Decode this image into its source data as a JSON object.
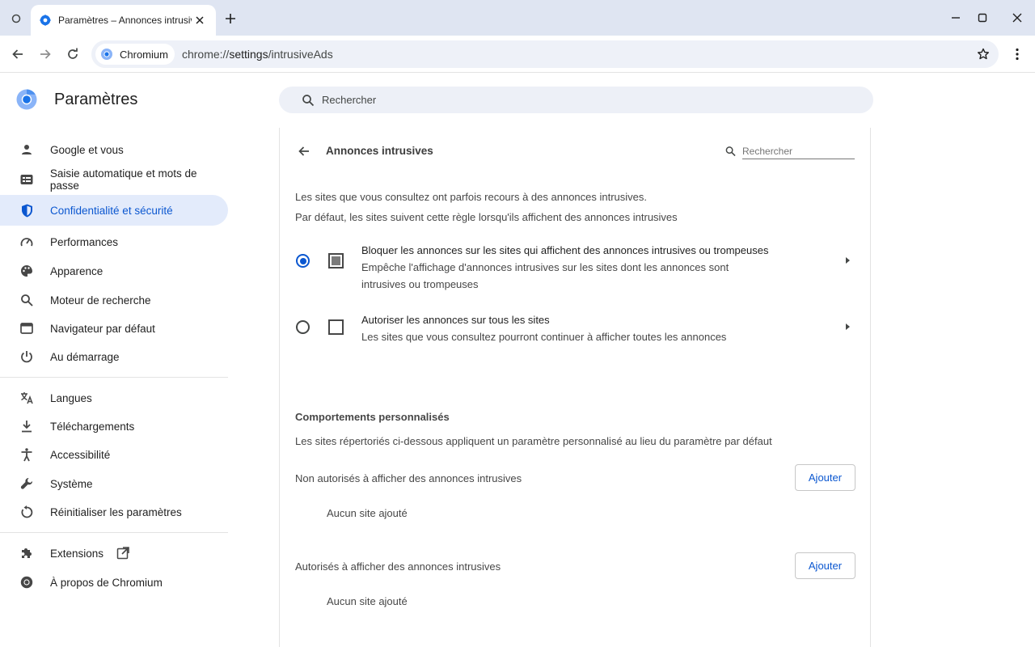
{
  "browser": {
    "tab_title": "Paramètres – Annonces intrusives",
    "chip_label": "Chromium",
    "url_scheme": "chrome://",
    "url_host": "settings",
    "url_path": "/intrusiveAds"
  },
  "settings": {
    "title": "Paramètres",
    "search_placeholder": "Rechercher"
  },
  "sidebar": {
    "items": [
      {
        "label": "Google et vous",
        "icon": "person-icon"
      },
      {
        "label": "Saisie automatique et mots de passe",
        "icon": "autofill-icon"
      },
      {
        "label": "Confidentialité et sécurité",
        "icon": "shield-icon",
        "active": true
      },
      {
        "label": "Performances",
        "icon": "speedometer-icon"
      },
      {
        "label": "Apparence",
        "icon": "palette-icon"
      },
      {
        "label": "Moteur de recherche",
        "icon": "search-icon"
      },
      {
        "label": "Navigateur par défaut",
        "icon": "browser-window-icon"
      },
      {
        "label": "Au démarrage",
        "icon": "power-icon"
      },
      {
        "label": "Langues",
        "icon": "translate-icon"
      },
      {
        "label": "Téléchargements",
        "icon": "download-icon"
      },
      {
        "label": "Accessibilité",
        "icon": "accessibility-icon"
      },
      {
        "label": "Système",
        "icon": "wrench-icon"
      },
      {
        "label": "Réinitialiser les paramètres",
        "icon": "reset-icon"
      },
      {
        "label": "Extensions",
        "icon": "puzzle-icon"
      },
      {
        "label": "À propos de Chromium",
        "icon": "chromium-icon"
      }
    ]
  },
  "page": {
    "title": "Annonces intrusives",
    "search_placeholder": "Rechercher",
    "desc1": "Les sites que vous consultez ont parfois recours à des annonces intrusives.",
    "desc2": "Par défaut, les sites suivent cette règle lorsqu'ils affichent des annonces intrusives",
    "options": [
      {
        "label": "Bloquer les annonces sur les sites qui affichent des annonces intrusives ou trompeuses",
        "sub": "Empêche l'affichage d'annonces intrusives sur les sites dont les annonces sont intrusives ou trompeuses",
        "selected": true
      },
      {
        "label": "Autoriser les annonces sur tous les sites",
        "sub": "Les sites que vous consultez pourront continuer à afficher toutes les annonces",
        "selected": false
      }
    ],
    "custom_heading": "Comportements personnalisés",
    "custom_desc": "Les sites répertoriés ci-dessous appliquent un paramètre personnalisé au lieu du paramètre par défaut",
    "blocked_label": "Non autorisés à afficher des annonces intrusives",
    "allowed_label": "Autorisés à afficher des annonces intrusives",
    "add_label": "Ajouter",
    "empty_label": "Aucun site ajouté"
  },
  "colors": {
    "accent": "#0b57d0",
    "active_nav_bg": "#e3ebfb",
    "tabstrip_bg": "#dfe5f2"
  }
}
